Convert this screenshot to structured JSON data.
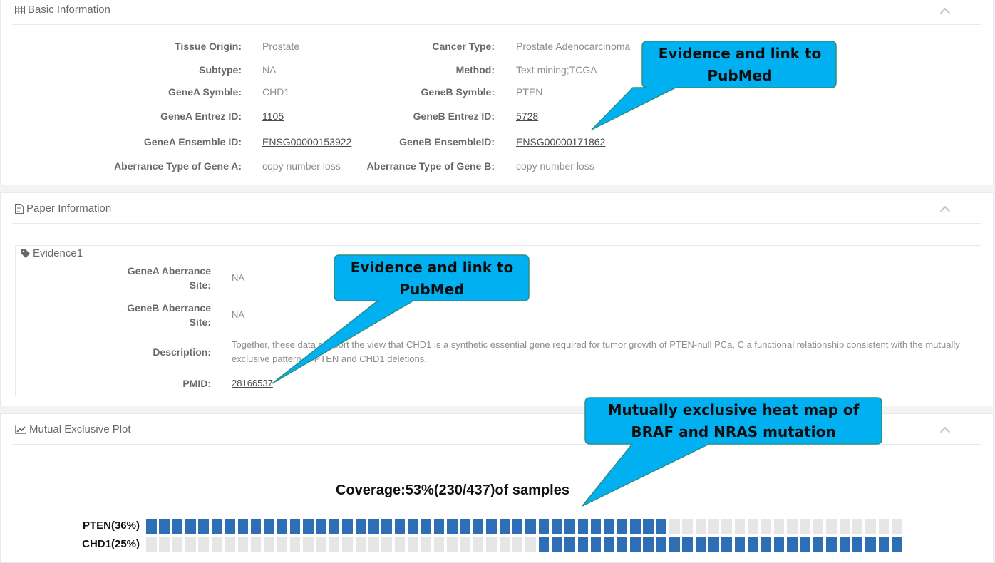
{
  "basic": {
    "title": "Basic Information",
    "rows": [
      {
        "l1": "Tissue Origin:",
        "v1": "Prostate",
        "l2": "Cancer Type:",
        "v2": "Prostate Adenocarcinoma"
      },
      {
        "l1": "Subtype:",
        "v1": "NA",
        "l2": "Method:",
        "v2": "Text mining;TCGA"
      },
      {
        "l1": "GeneA Symble:",
        "v1": "CHD1",
        "l2": "GeneB Symble:",
        "v2": "PTEN"
      },
      {
        "l1": "GeneA Entrez ID:",
        "v1": "1105",
        "l2": "GeneB Entrez ID:",
        "v2": "5728"
      },
      {
        "l1": "GeneA Ensemble ID:",
        "v1": "ENSG00000153922",
        "l2": "GeneB EnsembleID:",
        "v2": "ENSG00000171862"
      },
      {
        "l1": "Aberrance Type of Gene A:",
        "v1": "copy number loss",
        "l2": "Aberrance Type of Gene B:",
        "v2": "copy number loss"
      }
    ]
  },
  "paper": {
    "title": "Paper Information",
    "evidence_title": "Evidence1",
    "genea_label_1": "GeneA Aberrance",
    "genea_label_2": "Site:",
    "genea_value": "NA",
    "geneb_label_1": "GeneB Aberrance",
    "geneb_label_2": "Site:",
    "geneb_value": "NA",
    "description_label": "Description:",
    "description": "Together, these data support the view that CHD1 is a synthetic essential gene required for tumor growth of PTEN-null PCa, C a functional relationship consistent with the mutually exclusive pattern of PTEN and CHD1 deletions.",
    "pmid_label": "PMID:",
    "pmid": "28166537"
  },
  "plot": {
    "title": "Mutual Exclusive Plot",
    "coverage": "Coverage:53%(230/437)of samples",
    "genes": [
      {
        "label": "PTEN(36%)",
        "filled_from": 0,
        "filled_to": 40
      },
      {
        "label": "CHD1(25%)",
        "filled_from": 30,
        "filled_to": 58
      }
    ],
    "cells_per_row": 58,
    "filled_color": "#2e6eb5",
    "empty_color": "#e6e6e6"
  },
  "callouts": {
    "basic": "Evidence and link to PubMed",
    "paper": "Evidence and link to PubMed",
    "plot": "Mutually exclusive heat map of BRAF and NRAS mutation"
  },
  "colors": {
    "callout_fill": "#00b0f0",
    "callout_border": "#2a8f86"
  },
  "icons": {
    "basic": "table-icon",
    "paper": "file-text-icon",
    "evidence": "tag-icon",
    "plot": "line-chart-icon",
    "collapse": "chevron-up-icon"
  }
}
